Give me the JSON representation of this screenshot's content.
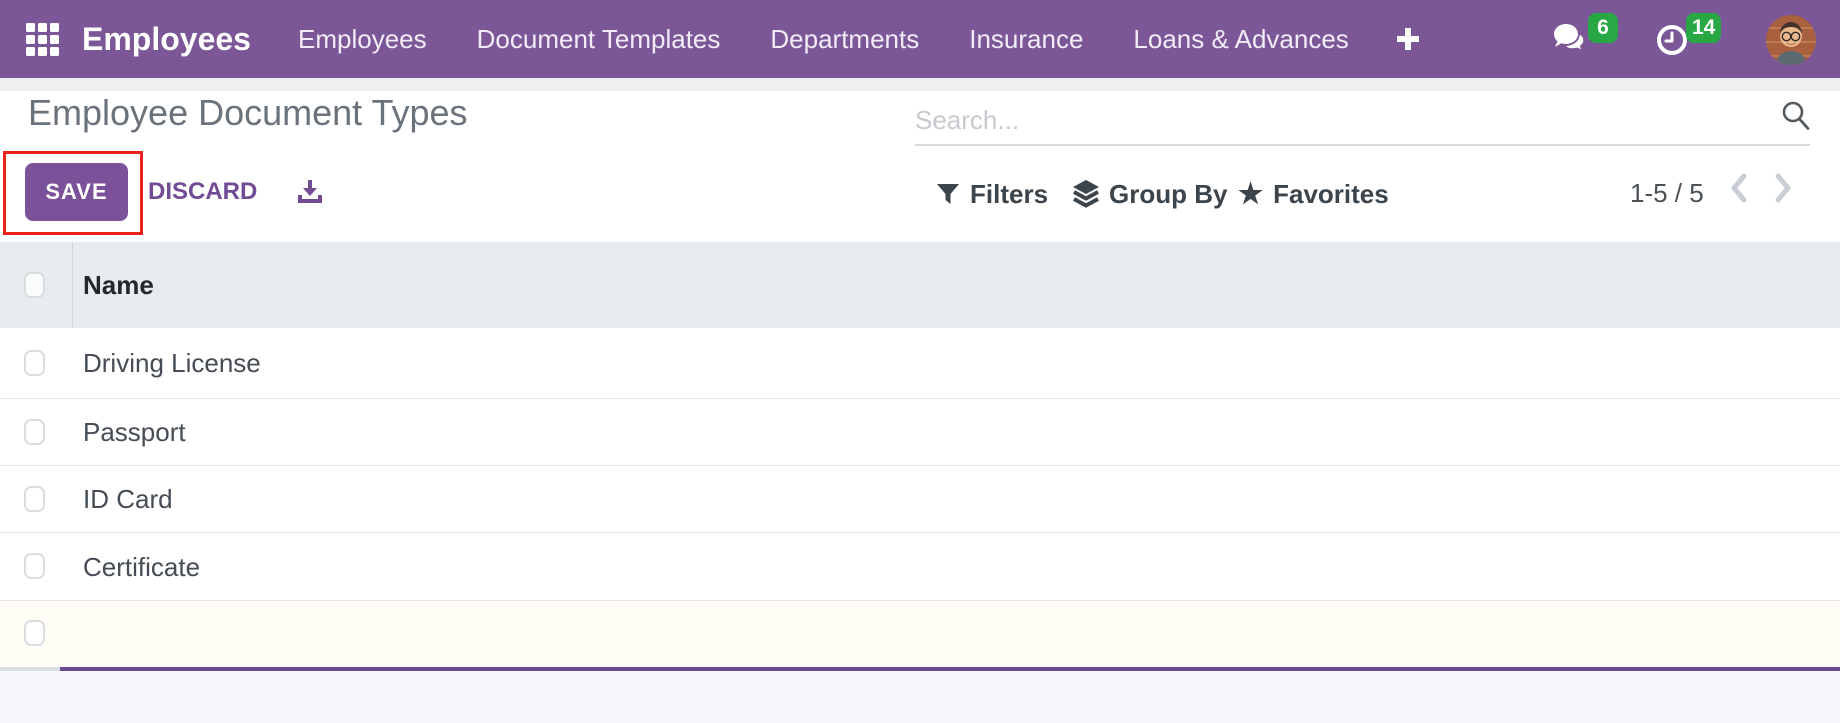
{
  "navbar": {
    "brand": "Employees",
    "menu_items": [
      "Employees",
      "Document Templates",
      "Departments",
      "Insurance",
      "Loans & Advances"
    ],
    "messages_count": "6",
    "activities_count": "14"
  },
  "control_panel": {
    "title": "Employee Document Types",
    "save_label": "SAVE",
    "discard_label": "DISCARD",
    "search_placeholder": "Search...",
    "filters_label": "Filters",
    "group_by_label": "Group By",
    "favorites_label": "Favorites",
    "pager": "1-5 / 5"
  },
  "table": {
    "columns": [
      "Name"
    ],
    "rows": [
      "Driving License",
      "Passport",
      "ID Card",
      "Certificate",
      ""
    ]
  },
  "icons": {
    "apps": "grid-3x3",
    "add_menu": "plus",
    "messages": "chat-bubbles",
    "activities": "clock",
    "export": "download-tray",
    "search": "magnifier",
    "filters": "funnel",
    "group_by": "layers",
    "favorites": "star",
    "pager_prev": "chevron-left",
    "pager_next": "chevron-right"
  },
  "colors": {
    "navbar_bg": "#7C5797",
    "accent_purple": "#714B94",
    "save_button_bg": "#7B5299",
    "badge_green": "#28A745",
    "annotation_red": "#E8241D",
    "table_header_bg": "#E9ECEF",
    "editing_row_line": "#6B4A90",
    "footer_bg": "#F5F6F9"
  }
}
